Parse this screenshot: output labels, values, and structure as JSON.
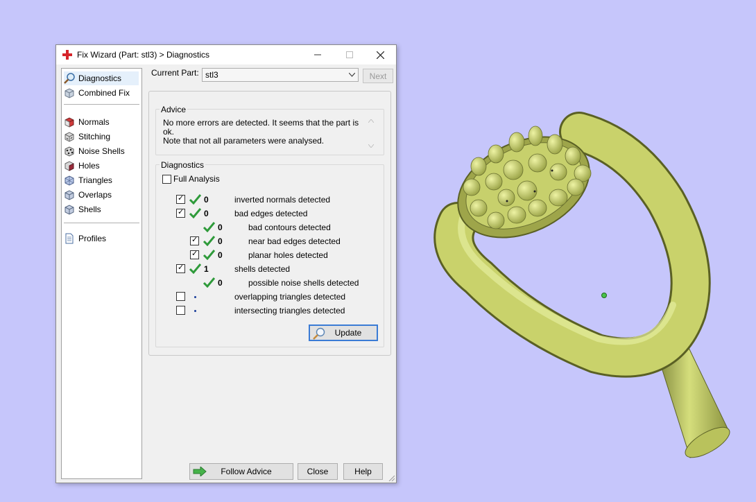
{
  "window": {
    "title": "Fix Wizard (Part: stl3) > Diagnostics",
    "icon": "red-cross-icon",
    "controls": [
      "minimize",
      "maximize",
      "close"
    ]
  },
  "sidebar": {
    "items": [
      {
        "label": "Diagnostics",
        "icon": "magnifier-icon",
        "selected": true
      },
      {
        "label": "Combined Fix",
        "icon": "cube-icon"
      },
      {
        "label": "Normals",
        "icon": "normals-cube-icon"
      },
      {
        "label": "Stitching",
        "icon": "stitching-icon"
      },
      {
        "label": "Noise Shells",
        "icon": "noise-shells-icon"
      },
      {
        "label": "Holes",
        "icon": "holes-icon"
      },
      {
        "label": "Triangles",
        "icon": "triangles-icon"
      },
      {
        "label": "Overlaps",
        "icon": "overlaps-icon"
      },
      {
        "label": "Shells",
        "icon": "shells-icon"
      },
      {
        "label": "Profiles",
        "icon": "document-icon"
      }
    ]
  },
  "header": {
    "current_part_label": "Current Part:",
    "current_part_value": "stl3",
    "next_label": "Next"
  },
  "advice": {
    "title": "Advice",
    "line1": "No more errors are detected. It seems that the part is ok.",
    "line2": "Note that not all parameters were analysed."
  },
  "diagnostics": {
    "title": "Diagnostics",
    "full_analysis_label": "Full Analysis",
    "full_analysis_checked": false,
    "rows": [
      {
        "label": "inverted normals detected",
        "value": "0",
        "checked": true,
        "status": "ok"
      },
      {
        "label": "bad edges detected",
        "value": "0",
        "checked": true,
        "status": "ok"
      },
      {
        "label": "bad contours detected",
        "value": "0",
        "status": "ok"
      },
      {
        "label": "near bad edges detected",
        "value": "0",
        "checked": true,
        "status": "ok"
      },
      {
        "label": "planar holes detected",
        "value": "0",
        "checked": true,
        "status": "ok"
      },
      {
        "label": "shells detected",
        "value": "1",
        "checked": true,
        "status": "ok"
      },
      {
        "label": "possible noise shells detected",
        "value": "0",
        "status": "ok"
      },
      {
        "label": "overlapping triangles detected",
        "value": "",
        "checked": false,
        "status": "pending"
      },
      {
        "label": "intersecting triangles detected",
        "value": "",
        "checked": false,
        "status": "pending"
      }
    ],
    "update_label": "Update"
  },
  "footer": {
    "follow_advice_label": "Follow Advice",
    "close_label": "Close",
    "help_label": "Help"
  },
  "colors": {
    "desktop": "#c6c6fb",
    "model": "#c8d46a",
    "check": "#2e9a3a",
    "selection": "#e5f0fb"
  }
}
